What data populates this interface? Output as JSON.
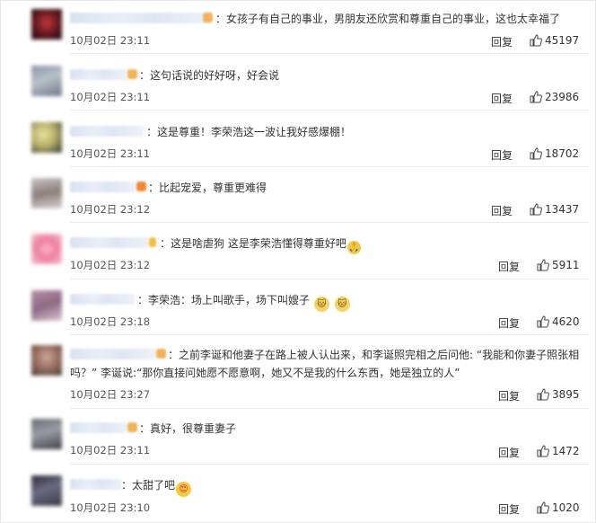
{
  "comments": [
    {
      "text": "女孩子有自己的事业，男朋友还欣赏和尊重自己的事业，这也太幸福了",
      "time": "10月02日 23:11",
      "reply": "回复",
      "likes": "45197",
      "emojis": []
    },
    {
      "text": "这句话说的好好呀，好会说",
      "time": "10月02日 23:11",
      "reply": "回复",
      "likes": "23986",
      "emojis": []
    },
    {
      "text": "这是尊重！李荣浩这一波让我好感爆棚！",
      "time": "10月02日 23:11",
      "reply": "回复",
      "likes": "18702",
      "emojis": []
    },
    {
      "text": "比起宠爱，尊重更难得",
      "time": "10月02日 23:12",
      "reply": "回复",
      "likes": "13437",
      "emojis": []
    },
    {
      "text": "这是啥虐狗 这是李荣浩懂得尊重好吧",
      "time": "10月02日 23:12",
      "reply": "回复",
      "likes": "5911",
      "emojis": [
        "pray-emoji"
      ]
    },
    {
      "text": "李荣浩：场上叫歌手，场下叫嫂子",
      "time": "10月02日 23:18",
      "reply": "回复",
      "likes": "4620",
      "emojis": [
        "cat-face-emoji",
        "cat-face-emoji"
      ]
    },
    {
      "text_line1": "之前李诞和他妻子在路上被人认出来，和李诞照完相之后问他: “我能和你妻子照张相",
      "text_line2": "吗？” 李诞说:“那你直接问她愿不愿意啊，她又不是我的什么东西，她是独立的人”",
      "time": "10月02日 23:27",
      "reply": "回复",
      "likes": "3895",
      "emojis": []
    },
    {
      "text": "真好，很尊重妻子",
      "time": "10月02日 23:11",
      "reply": "回复",
      "likes": "1472",
      "emojis": []
    },
    {
      "text": "太甜了吧",
      "time": "10月02日 23:10",
      "reply": "回复",
      "likes": "1020",
      "emojis": [
        "heart-eyes-emoji"
      ]
    }
  ],
  "colors": {
    "text": "#333333",
    "time": "#555555",
    "name_blur": "#d7e2f2",
    "divider": "#ececec"
  },
  "icons": {
    "like": "thumbs-up-icon"
  }
}
